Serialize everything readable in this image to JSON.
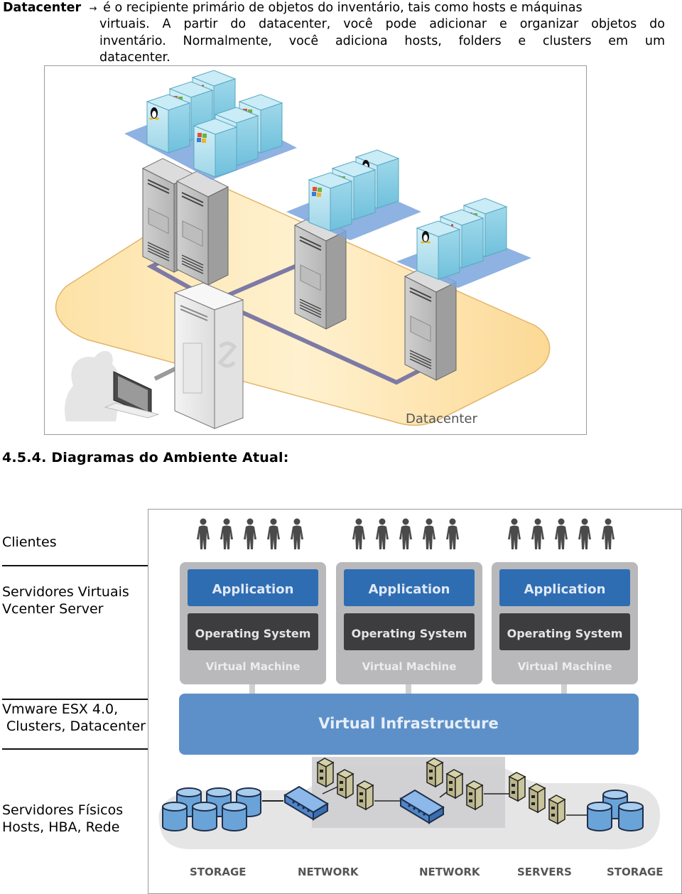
{
  "intro": {
    "term": "Datacenter",
    "arrow": "→",
    "line1_rest": " é o recipiente primário de objetos do inventário, tais como hosts e máquinas",
    "line2": "virtuais. A partir do datacenter, você pode adicionar e organizar objetos do",
    "line3": "inventário. Normalmente, você adiciona hosts, folders e clusters em um",
    "line4": "datacenter."
  },
  "figure1": {
    "caption": "Datacenter",
    "hosts": [
      {
        "name": "host-1",
        "vms": [
          "linux",
          "windows",
          "novell",
          "windows",
          "windows",
          "other"
        ]
      },
      {
        "name": "host-2",
        "vms": [
          "windows",
          "windows",
          "linux"
        ]
      },
      {
        "name": "host-3",
        "vms": [
          "linux",
          "novell",
          "windows"
        ]
      }
    ],
    "management_server": "vcenter-server",
    "client": "admin-workstation",
    "colors": {
      "floor": "#fde7b4",
      "network_link": "#7d7aa6",
      "vm_plate": "#7aa4dc",
      "vm_box": "#a9dcec",
      "server_gray": "#a7a7a7"
    }
  },
  "section": {
    "heading": "4.5.4. Diagramas do Ambiente  Atual:"
  },
  "layers": [
    {
      "label": "Clientes"
    },
    {
      "label": "Servidores Virtuais\nVcenter Server"
    },
    {
      "label": "Vmware ESX 4.0,\n Clusters, Datacenter"
    },
    {
      "label": "Servidores Físicos\nHosts, HBA, Rede"
    }
  ],
  "figure2": {
    "vm_stacks": [
      {
        "app": "Application",
        "os": "Operating System",
        "vm": "Virtual Machine"
      },
      {
        "app": "Application",
        "os": "Operating System",
        "vm": "Virtual Machine"
      },
      {
        "app": "Application",
        "os": "Operating System",
        "vm": "Virtual Machine"
      }
    ],
    "users_per_group": 5,
    "virtual_infrastructure": "Virtual Infrastructure",
    "resource_labels": [
      "STORAGE",
      "NETWORK",
      "NETWORK",
      "SERVERS",
      "STORAGE"
    ],
    "colors": {
      "application": "#2f6db3",
      "os": "#3d3d3f",
      "vm_frame": "#b9b9bb",
      "infrastructure": "#5d90c8",
      "user": "#4a4a4a",
      "server": "#b9b48a",
      "storage": "#6aa3d8",
      "switch": "#5a92d4"
    }
  }
}
